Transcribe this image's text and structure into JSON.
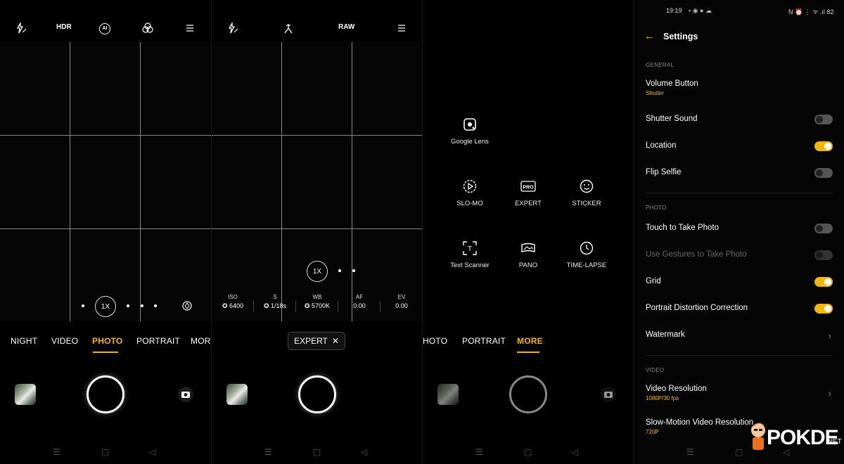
{
  "photo": {
    "top": {
      "flash_icon": "flash-auto-icon",
      "hdr": "HDR",
      "ai": "AI",
      "filter_icon": "filter-icon",
      "menu_icon": "menu-icon"
    },
    "zoom": "1X",
    "modes": [
      "NIGHT",
      "VIDEO",
      "PHOTO",
      "PORTRAIT",
      "MORE"
    ],
    "active_mode": "PHOTO",
    "accent": "#f2b705"
  },
  "expert": {
    "top": {
      "raw": "RAW"
    },
    "zoom": "1X",
    "params": [
      {
        "k": "ISO",
        "v": "6400",
        "auto": true
      },
      {
        "k": "S",
        "v": "1/18s",
        "auto": true
      },
      {
        "k": "WB",
        "v": "5700K",
        "auto": true
      },
      {
        "k": "AF",
        "v": "0.00",
        "auto": false
      },
      {
        "k": "EV",
        "v": "0.00",
        "auto": false
      }
    ],
    "chip": "EXPERT",
    "chip_close": "✕"
  },
  "more": {
    "tiles": [
      {
        "label": "Google Lens",
        "icon": "google-lens-icon"
      },
      {
        "label": "SLO-MO",
        "icon": "slo-mo-icon"
      },
      {
        "label": "EXPERT",
        "icon": "pro-icon",
        "icon_text": "PRO"
      },
      {
        "label": "STICKER",
        "icon": "sticker-icon"
      },
      {
        "label": "Text Scanner",
        "icon": "text-scanner-icon",
        "icon_text": "T"
      },
      {
        "label": "PANO",
        "icon": "pano-icon"
      },
      {
        "label": "TIME-LAPSE",
        "icon": "time-lapse-icon"
      }
    ],
    "modes": [
      "HOTO",
      "PORTRAIT",
      "MORE"
    ],
    "active_mode": "MORE"
  },
  "settings": {
    "time": "19:19",
    "status_right": "N ⏰ ⋮ ᯤ .ıl 82",
    "title": "Settings",
    "sections": {
      "general": "GENERAL",
      "photo": "PHOTO",
      "video": "VIDEO"
    },
    "rows": {
      "volume": {
        "t": "Volume Button",
        "sub": "Shutter"
      },
      "shutter_sound": {
        "t": "Shutter Sound",
        "on": false
      },
      "location": {
        "t": "Location",
        "on": true
      },
      "flip_selfie": {
        "t": "Flip Selfie",
        "on": false
      },
      "touch_photo": {
        "t": "Touch to Take Photo",
        "on": false
      },
      "gestures": {
        "t": "Use Gestures to Take Photo",
        "on": false
      },
      "grid": {
        "t": "Grid",
        "on": true
      },
      "portrait_dist": {
        "t": "Portrait Distortion Correction",
        "on": true
      },
      "watermark": {
        "t": "Watermark"
      },
      "video_res": {
        "t": "Video Resolution",
        "sub": "1080P/30 fps"
      },
      "slowmo_res": {
        "t": "Slow-Motion Video Resolution",
        "sub": "720P"
      }
    },
    "watermark_brand": "POKDE",
    "watermark_suffix": ".NET"
  },
  "nav": {
    "menu": "☰",
    "home": "▢",
    "back": "◁"
  }
}
